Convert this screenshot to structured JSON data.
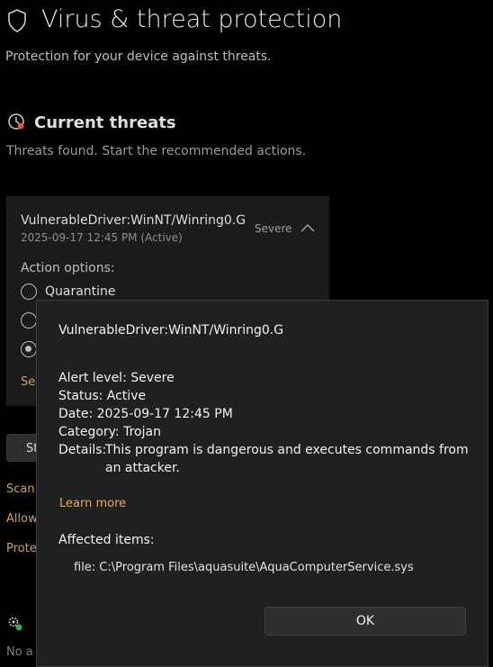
{
  "page": {
    "title": "Virus & threat protection",
    "subtitle": "Protection for your device against threats."
  },
  "current_threats": {
    "title": "Current threats",
    "subtitle": "Threats found. Start the recommended actions.",
    "threat": {
      "name": "VulnerableDriver:WinNT/Winring0.G",
      "date_status": "2025-09-17 12:45 PM (Active)",
      "severity": "Severe",
      "action_options_label": "Action options:",
      "options": [
        "Quarantine"
      ],
      "see_link": "See"
    },
    "start_button": "St",
    "links": [
      "Scan",
      "Allow",
      "Prote"
    ]
  },
  "bottom": {
    "text": "No a"
  },
  "dialog": {
    "threat_name": "VulnerableDriver:WinNT/Winring0.G",
    "alert_level_label": "Alert level:",
    "alert_level_value": "Severe",
    "status_label": "Status:",
    "status_value": "Active",
    "date_label": "Date:",
    "date_value": "2025-09-17 12:45 PM",
    "category_label": "Category:",
    "category_value": "Trojan",
    "details_label": "Details:",
    "details_value": "This program is dangerous and executes commands from an attacker.",
    "learn_more": "Learn more",
    "affected_label": "Affected items:",
    "affected_item": "file: C:\\Program Files\\aquasuite\\AquaComputerService.sys",
    "ok_label": "OK"
  }
}
